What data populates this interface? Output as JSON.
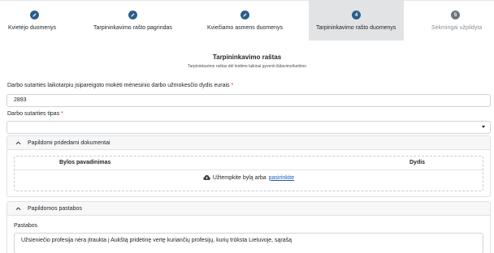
{
  "stepper": {
    "steps": [
      {
        "number": "",
        "label": "Kvietėjo duomenys",
        "state": "done",
        "icon": "pencil-icon"
      },
      {
        "number": "",
        "label": "Tarpininkavimo rašto pagrindas",
        "state": "done",
        "icon": "pencil-icon"
      },
      {
        "number": "",
        "label": "Kviečiamo asmens duomenys",
        "state": "done",
        "icon": "pencil-icon"
      },
      {
        "number": "4",
        "label": "Tarpininkavimo rašto duomenys",
        "state": "active"
      },
      {
        "number": "5",
        "label": "Sėkmingai užpildyta",
        "state": "pending"
      }
    ]
  },
  "form": {
    "title": "Tarpininkavimo raštas",
    "subtitle": "Tarpininkavimo raštas dėl leidimo laikinai gyventi išdavimo/keitimo"
  },
  "salary_field": {
    "label": "Darbo sutarties laikotarpiu įsipareigoto mokėti mėnesinio darbo užmokesčio dydis eurais",
    "required_mark": "*",
    "value": "2893"
  },
  "contract_type_field": {
    "label": "Darbo sutarties tipas",
    "required_mark": "*",
    "value": ""
  },
  "documents_panel": {
    "title": "Papildomi pridedami dokumentai",
    "col_name": "Bylos pavadinimas",
    "col_size": "Dydis",
    "dropzone_text": "Užtempkite bylą arba",
    "dropzone_link": "pasirinkite"
  },
  "notes_panel": {
    "title": "Papildomos pastabos",
    "notes_label": "Pastabos",
    "notes_value": "Užsieniečio profesija nėra įtraukta į Aukštą pridėtinę vertę kuriančių profesijų, kurių trūksta Lietuvoje, sąrašą"
  },
  "colors": {
    "step_done": "#2b5d8a",
    "step_pending": "#6c757d",
    "active_bg": "#e2e3e5",
    "link": "#1a5fb4",
    "required": "#d93025"
  }
}
